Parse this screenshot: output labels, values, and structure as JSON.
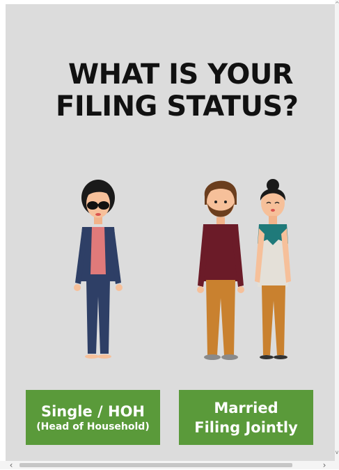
{
  "headline": {
    "line1": "WHAT IS YOUR",
    "line2": "FILING STATUS?"
  },
  "options": {
    "single": {
      "label": "Single / HOH",
      "sublabel": "(Head of Household)"
    },
    "married": {
      "line1": "Married",
      "line2": "Filing Jointly"
    }
  },
  "colors": {
    "background": "#dcdcdc",
    "button": "#5a9a3a",
    "button_text": "#ffffff",
    "headline": "#111111"
  },
  "icons": {
    "single_person": "woman-with-sunglasses-illustration",
    "couple": "couple-illustration"
  },
  "scrollbars": {
    "left_arrow": "‹",
    "right_arrow": "›",
    "up_arrow": "^",
    "down_arrow": "v"
  }
}
